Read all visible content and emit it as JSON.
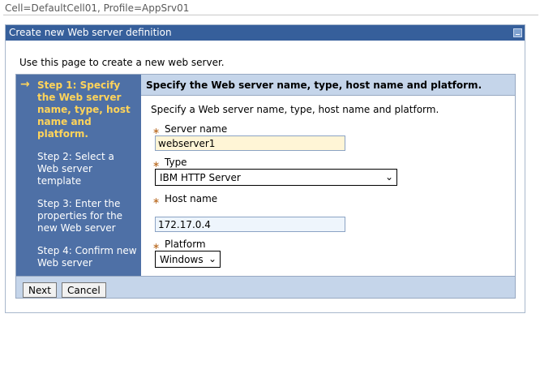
{
  "context": "Cell=DefaultCell01, Profile=AppSrv01",
  "panel": {
    "title": "Create new Web server definition",
    "collapse_icon": "minus-icon",
    "intro": "Use this page to create a new web server."
  },
  "steps": [
    {
      "label": "Step 1: Specify the Web server name, type, host name and platform.",
      "active": true
    },
    {
      "label": "Step 2: Select a Web server template",
      "active": false
    },
    {
      "label": "Step 3: Enter the properties for the new Web server",
      "active": false
    },
    {
      "label": "Step 4: Confirm new Web server",
      "active": false
    }
  ],
  "current_step_arrow": "→",
  "form": {
    "title": "Specify the Web server name, type, host name and platform.",
    "description": "Specify a Web server name, type, host name and platform.",
    "required_marker": "∗",
    "server_name": {
      "label": "Server name",
      "value": "webserver1"
    },
    "type": {
      "label": "Type",
      "value": "IBM HTTP Server"
    },
    "host_name": {
      "label": "Host name",
      "value": "172.17.0.4"
    },
    "platform": {
      "label": "Platform",
      "value": "Windows"
    }
  },
  "buttons": {
    "next": "Next",
    "cancel": "Cancel"
  },
  "chevron": "⌄",
  "colors": {
    "header": "#365f9b",
    "steps_bg": "#4e70a6",
    "active_step": "#ffd45a",
    "title_bar": "#c5d5ea",
    "input_highlight": "#fff5d6"
  }
}
